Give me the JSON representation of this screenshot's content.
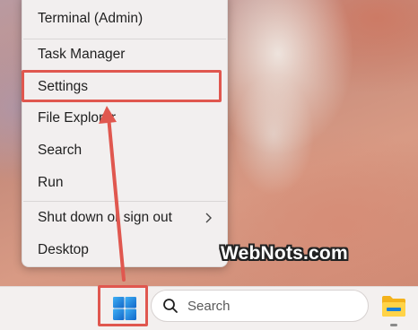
{
  "context_menu": {
    "items": [
      {
        "label": "Terminal (Admin)"
      },
      {
        "label": "Task Manager"
      },
      {
        "label": "Settings"
      },
      {
        "label": "File Explorer"
      },
      {
        "label": "Search"
      },
      {
        "label": "Run"
      },
      {
        "label": "Shut down or sign out",
        "has_submenu": true
      },
      {
        "label": "Desktop"
      }
    ],
    "highlighted": "Settings"
  },
  "taskbar": {
    "start_icon": "windows-start-icon",
    "search": {
      "icon": "search-icon",
      "placeholder": "Search"
    },
    "pinned": [
      {
        "icon": "file-explorer-icon"
      }
    ]
  },
  "watermark": "WebNots.com",
  "colors": {
    "annotation": "#e0574f",
    "menu_bg": "#f2efef",
    "taskbar_bg": "#f3f0ef",
    "windows_blue": "#1a7fd6"
  }
}
